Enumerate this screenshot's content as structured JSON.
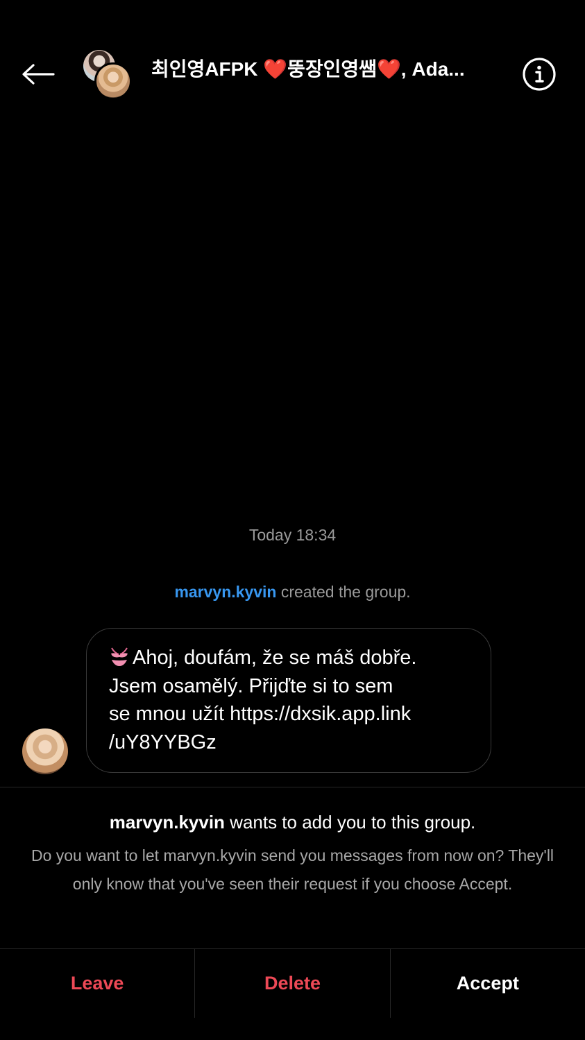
{
  "header": {
    "back_icon": "arrow-left-icon",
    "title": "최인영AFPK ❤️뚱장인영쌤❤️, Ada...",
    "info_icon": "info-circle-icon"
  },
  "conversation": {
    "timestamp": "Today 18:34",
    "system_message": {
      "username": "marvyn.kyvin",
      "text": " created the group."
    },
    "message": {
      "sender": "marvyn.kyvin",
      "emoji_icon": "bikini-emoji-icon",
      "lines": [
        "Ahoj, doufám, že se máš dobře.",
        "Jsem osamělý. Přijďte si to sem",
        "se mnou užít https://dxsik.app.link",
        "/uY8YYBGz"
      ]
    }
  },
  "request": {
    "username": "marvyn.kyvin",
    "title_rest": " wants to add you to this group.",
    "body": "Do you want to let marvyn.kyvin send you messages from now on? They'll only know that you've seen their request if you choose Accept."
  },
  "actions": {
    "leave": "Leave",
    "delete": "Delete",
    "accept": "Accept"
  },
  "colors": {
    "background": "#000000",
    "link": "#3897f0",
    "danger": "#ed4956",
    "muted": "#9a9a9a"
  }
}
